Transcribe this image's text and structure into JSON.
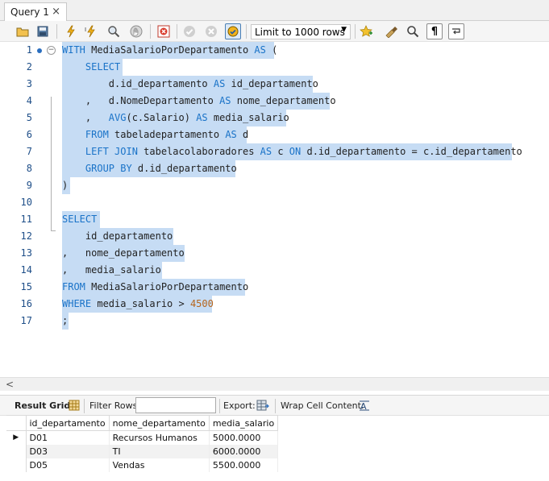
{
  "tab": {
    "title": "Query 1",
    "close": "×"
  },
  "toolbar": {
    "limit_label": "Limit to 1000 rows",
    "icons": [
      "open-folder-icon",
      "save-icon",
      "execute-icon",
      "execute-current-icon",
      "explain-icon",
      "stop-icon",
      "toggle-error-icon",
      "commit-icon",
      "rollback-icon",
      "autocommit-icon",
      "bookmark-icon",
      "beautify-icon",
      "find-icon",
      "invisible-chars-icon",
      "word-wrap-icon"
    ]
  },
  "editor": {
    "lines": [
      {
        "n": "1",
        "html": "<span class='kw'>WITH</span> MediaSalarioPorDepartamento <span class='kw'>AS</span> (",
        "hl": [
          77,
          340
        ]
      },
      {
        "n": "2",
        "html": "    <span class='kw'>SELECT</span>",
        "hl": [
          77,
          152
        ]
      },
      {
        "n": "3",
        "html": "        d.id_departamento <span class='kw'>AS</span> id_departamento",
        "hl": [
          77,
          388
        ]
      },
      {
        "n": "4",
        "html": "    ,   d.NomeDepartamento <span class='kw'>AS</span> nome_departamento",
        "hl": [
          77,
          409
        ]
      },
      {
        "n": "5",
        "html": "    ,   <span class='kw'>AVG</span>(c.Salario) <span class='kw'>AS</span> media_salario",
        "hl": [
          77,
          355
        ]
      },
      {
        "n": "6",
        "html": "    <span class='kw'>FROM</span> tabeladepartamento <span class='kw'>AS</span> d",
        "hl": [
          77,
          306
        ]
      },
      {
        "n": "7",
        "html": "    <span class='kw'>LEFT JOIN</span> tabelacolaboradores <span class='kw'>AS</span> c <span class='kw'>ON</span> d.id_departamento = c.id_departamento",
        "hl": [
          77,
          635
        ]
      },
      {
        "n": "8",
        "html": "    <span class='kw'>GROUP BY</span> d.id_departamento",
        "hl": [
          77,
          292
        ]
      },
      {
        "n": "9",
        "html": ")",
        "hl": [
          77,
          87
        ]
      },
      {
        "n": "10",
        "html": "",
        "hl": null
      },
      {
        "n": "11",
        "html": "<span class='kw'>SELECT</span>",
        "hl": [
          77,
          124
        ]
      },
      {
        "n": "12",
        "html": "    id_departamento",
        "hl": [
          77,
          215
        ]
      },
      {
        "n": "13",
        "html": ",   nome_departamento",
        "hl": [
          77,
          229
        ]
      },
      {
        "n": "14",
        "html": ",   media_salario",
        "hl": [
          77,
          201
        ]
      },
      {
        "n": "15",
        "html": "<span class='kw'>FROM</span> MediaSalarioPorDepartamento",
        "hl": [
          77,
          304
        ]
      },
      {
        "n": "16",
        "html": "<span class='kw'>WHERE</span> media_salario &gt; <span class='num'>4500</span>",
        "hl": [
          77,
          263
        ]
      },
      {
        "n": "17",
        "html": ";",
        "hl": [
          77,
          85
        ]
      }
    ]
  },
  "result_toolbar": {
    "result_grid": "Result Grid",
    "filter_rows": "Filter Rows:",
    "export": "Export:",
    "wrap_cell": "Wrap Cell Content:"
  },
  "grid": {
    "columns": [
      "id_departamento",
      "nome_departamento",
      "media_salario"
    ],
    "rows": [
      [
        "D01",
        "Recursos Humanos",
        "5000.0000"
      ],
      [
        "D03",
        "TI",
        "6000.0000"
      ],
      [
        "D05",
        "Vendas",
        "5500.0000"
      ]
    ]
  }
}
